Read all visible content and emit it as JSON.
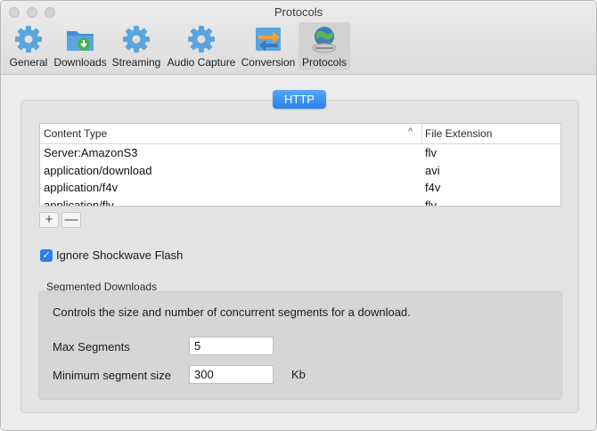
{
  "window": {
    "title": "Protocols"
  },
  "toolbar": {
    "tabs": [
      {
        "label": "General",
        "icon": "gear-icon"
      },
      {
        "label": "Downloads",
        "icon": "download-folder-icon"
      },
      {
        "label": "Streaming",
        "icon": "gear-icon"
      },
      {
        "label": "Audio Capture",
        "icon": "gear-icon"
      },
      {
        "label": "Conversion",
        "icon": "convert-arrows-icon"
      },
      {
        "label": "Protocols",
        "icon": "globe-link-icon",
        "selected": true
      }
    ]
  },
  "segment": {
    "label": "HTTP"
  },
  "table": {
    "columns": [
      "Content Type",
      "File Extension"
    ],
    "sort_indicator": "^",
    "rows": [
      [
        "Server:AmazonS3",
        "flv"
      ],
      [
        "application/download",
        "avi"
      ],
      [
        "application/f4v",
        "f4v"
      ],
      [
        "application/flv",
        "flv"
      ]
    ],
    "add_label": "+",
    "remove_label": "—"
  },
  "options": {
    "ignore_flash_label": "Ignore Shockwave Flash",
    "ignore_flash_checked": true,
    "check_mark": "✓"
  },
  "segmented": {
    "title": "Segmented Downloads",
    "description": "Controls the size and number of concurrent segments for a download.",
    "max_segments_label": "Max Segments",
    "max_segments_value": "5",
    "min_size_label": "Minimum segment size",
    "min_size_value": "300",
    "min_size_unit": "Kb"
  },
  "colors": {
    "accent": "#2a7fe9",
    "gear": "#5aa5dc",
    "folder": "#3d8fd0",
    "download_badge": "#4caf50"
  }
}
